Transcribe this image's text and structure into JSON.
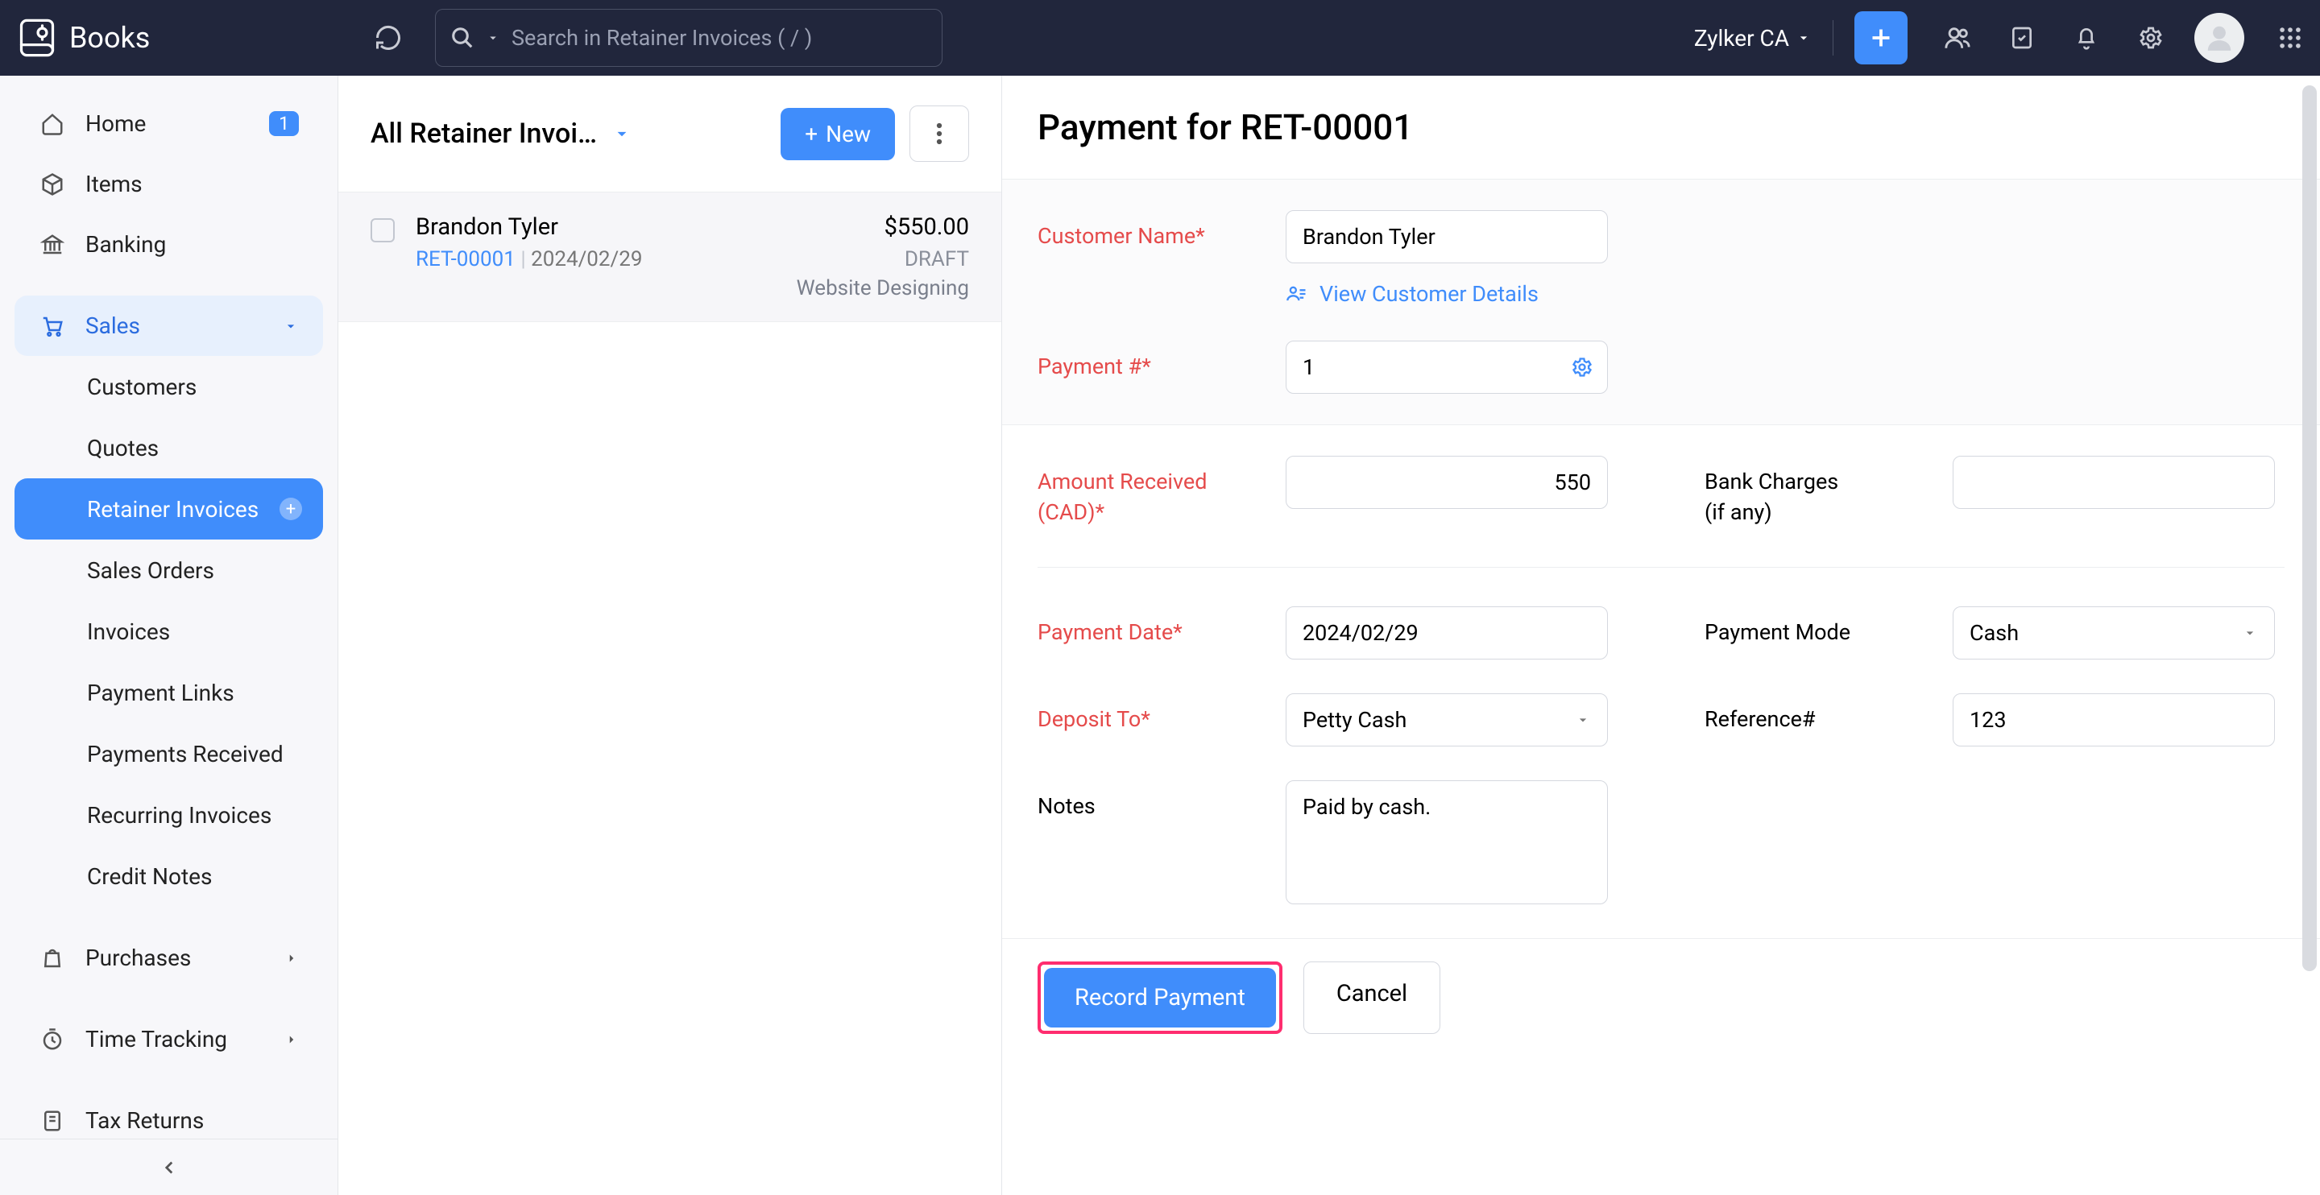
{
  "app": {
    "name": "Books"
  },
  "topbar": {
    "search_placeholder": "Search in Retainer Invoices ( / )",
    "org_name": "Zylker CA"
  },
  "sidebar": {
    "items": [
      {
        "label": "Home",
        "badge": "1",
        "icon": "home"
      },
      {
        "label": "Items",
        "icon": "cube"
      },
      {
        "label": "Banking",
        "icon": "bank"
      },
      {
        "label": "Sales",
        "icon": "cart",
        "expanded": true
      },
      {
        "label": "Purchases",
        "icon": "bag"
      },
      {
        "label": "Time Tracking",
        "icon": "clock"
      },
      {
        "label": "Tax Returns",
        "icon": "receipt"
      }
    ],
    "sales_sub": [
      {
        "label": "Customers"
      },
      {
        "label": "Quotes"
      },
      {
        "label": "Retainer Invoices",
        "active": true
      },
      {
        "label": "Sales Orders"
      },
      {
        "label": "Invoices"
      },
      {
        "label": "Payment Links"
      },
      {
        "label": "Payments Received"
      },
      {
        "label": "Recurring Invoices"
      },
      {
        "label": "Credit Notes"
      }
    ]
  },
  "list": {
    "title": "All Retainer Invoi…",
    "new_btn": "New",
    "rows": [
      {
        "customer": "Brandon Tyler",
        "amount": "$550.00",
        "number": "RET-00001",
        "date": "2024/02/29",
        "status": "DRAFT",
        "project": "Website Designing"
      }
    ]
  },
  "detail": {
    "title": "Payment for RET-00001",
    "view_customer_link": "View Customer Details",
    "labels": {
      "customer_name": "Customer Name*",
      "payment_no": "Payment #*",
      "amount_received": "Amount Received (CAD)*",
      "bank_charges_l1": "Bank Charges",
      "bank_charges_l2": "(if any)",
      "payment_date": "Payment Date*",
      "payment_mode": "Payment Mode",
      "deposit_to": "Deposit To*",
      "reference": "Reference#",
      "notes": "Notes"
    },
    "values": {
      "customer_name": "Brandon Tyler",
      "payment_no": "1",
      "amount_received": "550",
      "bank_charges": "",
      "payment_date": "2024/02/29",
      "payment_mode": "Cash",
      "deposit_to": "Petty Cash",
      "reference": "123",
      "notes": "Paid by cash."
    },
    "buttons": {
      "record": "Record Payment",
      "cancel": "Cancel"
    }
  }
}
